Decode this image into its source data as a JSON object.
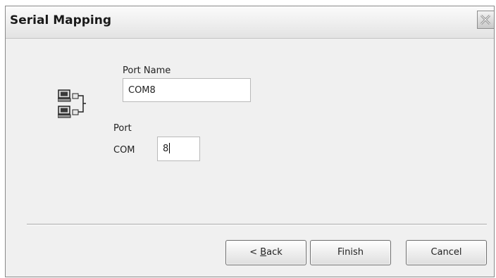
{
  "dialog": {
    "title": "Serial Mapping"
  },
  "form": {
    "port_name_label": "Port Name",
    "port_name_value": "COM8",
    "port_label": "Port",
    "com_prefix": "COM",
    "com_value": "8"
  },
  "buttons": {
    "back_prefix": "< ",
    "back_mnemonic": "B",
    "back_rest": "ack",
    "finish": "Finish",
    "cancel": "Cancel"
  }
}
